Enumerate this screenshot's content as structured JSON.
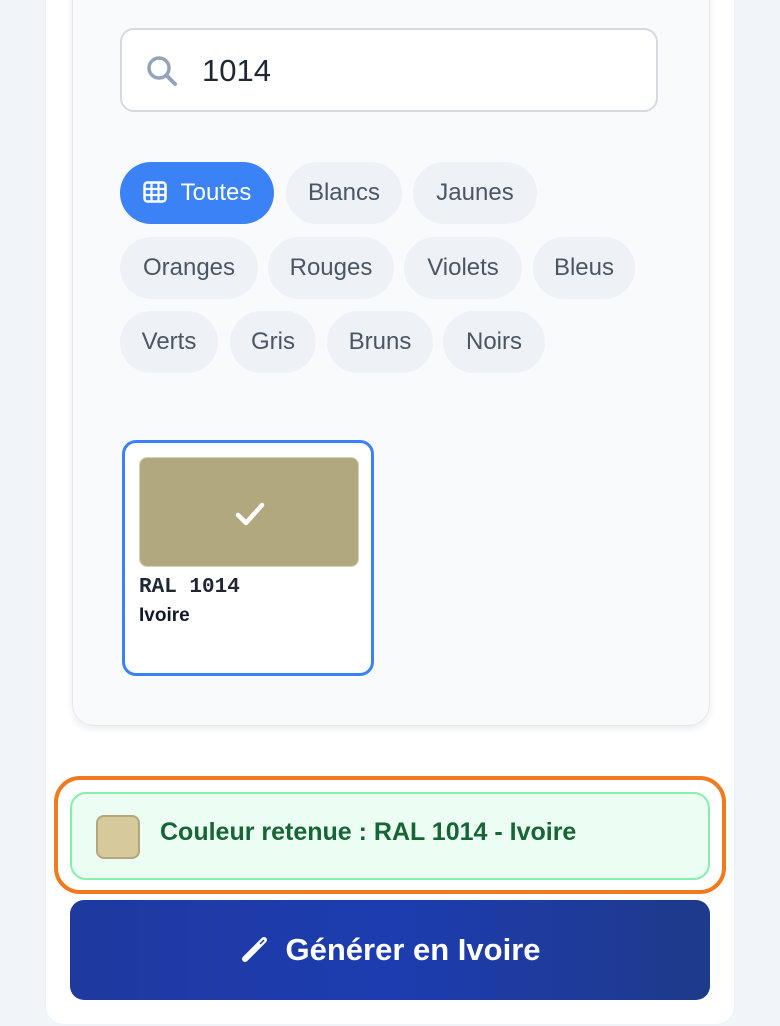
{
  "search": {
    "value": "1014",
    "icon": "search-icon"
  },
  "filters": {
    "items": [
      {
        "label": "Toutes",
        "active": true,
        "icon": "grid-icon"
      },
      {
        "label": "Blancs",
        "active": false
      },
      {
        "label": "Jaunes",
        "active": false
      },
      {
        "label": "Oranges",
        "active": false
      },
      {
        "label": "Rouges",
        "active": false
      },
      {
        "label": "Violets",
        "active": false
      },
      {
        "label": "Bleus",
        "active": false
      },
      {
        "label": "Verts",
        "active": false
      },
      {
        "label": "Gris",
        "active": false
      },
      {
        "label": "Bruns",
        "active": false
      },
      {
        "label": "Noirs",
        "active": false
      }
    ]
  },
  "results": {
    "items": [
      {
        "code": "RAL 1014",
        "name": "Ivoire",
        "color": "#b2a880",
        "selected": true
      }
    ]
  },
  "selection": {
    "text": "Couleur retenue : RAL 1014 - Ivoire",
    "swatch_color": "#d6c99b"
  },
  "generate_button": {
    "label": "Générer en Ivoire",
    "icon": "pencil-icon"
  },
  "colors": {
    "accent": "#3b82f6",
    "highlight_outline": "#f07a1f",
    "success_text": "#166534",
    "button_dark": "#1e3a9f"
  }
}
